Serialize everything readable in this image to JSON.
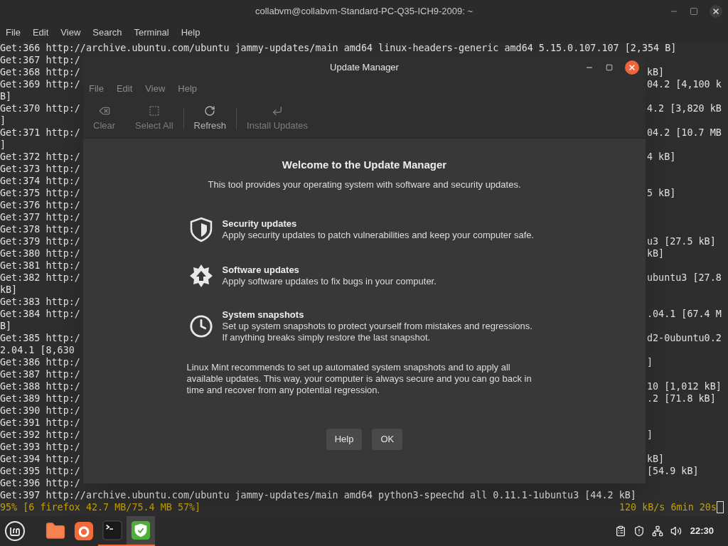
{
  "terminal": {
    "title": "collabvm@collabvm-Standard-PC-Q35-ICH9-2009: ~",
    "menu": [
      "File",
      "Edit",
      "View",
      "Search",
      "Terminal",
      "Help"
    ],
    "lines": [
      {
        "left": "Get:366 http://archive.ubuntu.com/ubuntu jammy-updates/main amd64 linux-headers-generic amd64 5.15.0.107.107 [2,354 B]"
      },
      {
        "left": "Get:367 http:/"
      },
      {
        "left": "Get:368 http:/",
        "right": "kB]"
      },
      {
        "left": "Get:369 http:/",
        "right": "04.2 [4,100 k"
      },
      {
        "left": "B]"
      },
      {
        "left": "Get:370 http:/",
        "right": "4.2 [3,820 kB"
      },
      {
        "left": "]"
      },
      {
        "left": "Get:371 http:/",
        "right": "04.2 [10.7 MB"
      },
      {
        "left": "]"
      },
      {
        "left": "Get:372 http:/",
        "right": "4 kB]"
      },
      {
        "left": "Get:373 http:/"
      },
      {
        "left": "Get:374 http:/"
      },
      {
        "left": "Get:375 http:/",
        "right": "5 kB]"
      },
      {
        "left": "Get:376 http:/"
      },
      {
        "left": "Get:377 http:/"
      },
      {
        "left": "Get:378 http:/"
      },
      {
        "left": "Get:379 http:/",
        "right": "u3 [27.5 kB]"
      },
      {
        "left": "Get:380 http:/",
        "right": "kB]"
      },
      {
        "left": "Get:381 http:/"
      },
      {
        "left": "Get:382 http:/",
        "right": "ubuntu3 [27.8"
      },
      {
        "left": "kB]"
      },
      {
        "left": "Get:383 http:/"
      },
      {
        "left": "Get:384 http:/",
        "right": ".04.1 [67.4 M"
      },
      {
        "left": "B]"
      },
      {
        "left": "Get:385 http:/",
        "right": "d2-0ubuntu0.2"
      },
      {
        "left": "2.04.1 [8,630"
      },
      {
        "left": "Get:386 http:/",
        "right": "]"
      },
      {
        "left": "Get:387 http:/"
      },
      {
        "left": "Get:388 http:/",
        "right": "10 [1,012 kB]"
      },
      {
        "left": "Get:389 http:/",
        "right": ".2 [71.8 kB]"
      },
      {
        "left": "Get:390 http:/"
      },
      {
        "left": "Get:391 http:/"
      },
      {
        "left": "Get:392 http:/",
        "right": "]"
      },
      {
        "left": "Get:393 http:/"
      },
      {
        "left": "Get:394 http:/",
        "right": "kB]"
      },
      {
        "left": "Get:395 http:/",
        "right": "[54.9 kB]"
      },
      {
        "left": "Get:396 http:/"
      },
      {
        "left": "Get:397 http://archive.ubuntu.com/ubuntu jammy-updates/main amd64 python3-speechd all 0.11.1-1ubuntu3 [44.2 kB]"
      }
    ],
    "status": {
      "left": "95% [6 firefox 42.7 MB/75.4 MB 57%]",
      "right": "120 kB/s 6min 20s"
    }
  },
  "dialog": {
    "title": "Update Manager",
    "menu": [
      "File",
      "Edit",
      "View",
      "Help"
    ],
    "toolbar": [
      {
        "kind": "clear",
        "label": "Clear",
        "disabled": true
      },
      {
        "kind": "select",
        "label": "Select All",
        "disabled": true
      },
      {
        "kind": "refresh",
        "label": "Refresh",
        "disabled": false
      },
      {
        "kind": "install",
        "label": "Install Updates",
        "disabled": true
      }
    ],
    "heading": "Welcome to the Update Manager",
    "subtitle": "This tool provides your operating system with software and security updates.",
    "features": [
      {
        "kind": "security",
        "title": "Security updates",
        "text": "Apply security updates to patch vulnerabilities and keep your computer safe."
      },
      {
        "kind": "software",
        "title": "Software updates",
        "text": "Apply software updates to fix bugs in your computer."
      },
      {
        "kind": "snapshots",
        "title": "System snapshots",
        "text": "Set up system snapshots to protect yourself from mistakes and regressions. If anything breaks simply restore the last snapshot."
      }
    ],
    "note": "Linux Mint recommends to set up automated system snapshots and to apply all available updates. This way, your computer is always secure and you can go back in time and recover from any potential regression.",
    "buttons": [
      "Help",
      "OK"
    ]
  },
  "taskbar": {
    "apps": [
      {
        "kind": "files",
        "selected": false,
        "running": false
      },
      {
        "kind": "firefox",
        "selected": false,
        "running": false
      },
      {
        "kind": "terminal",
        "selected": false,
        "running": true
      },
      {
        "kind": "updates",
        "selected": true,
        "running": true
      }
    ],
    "clock": "22:30"
  }
}
